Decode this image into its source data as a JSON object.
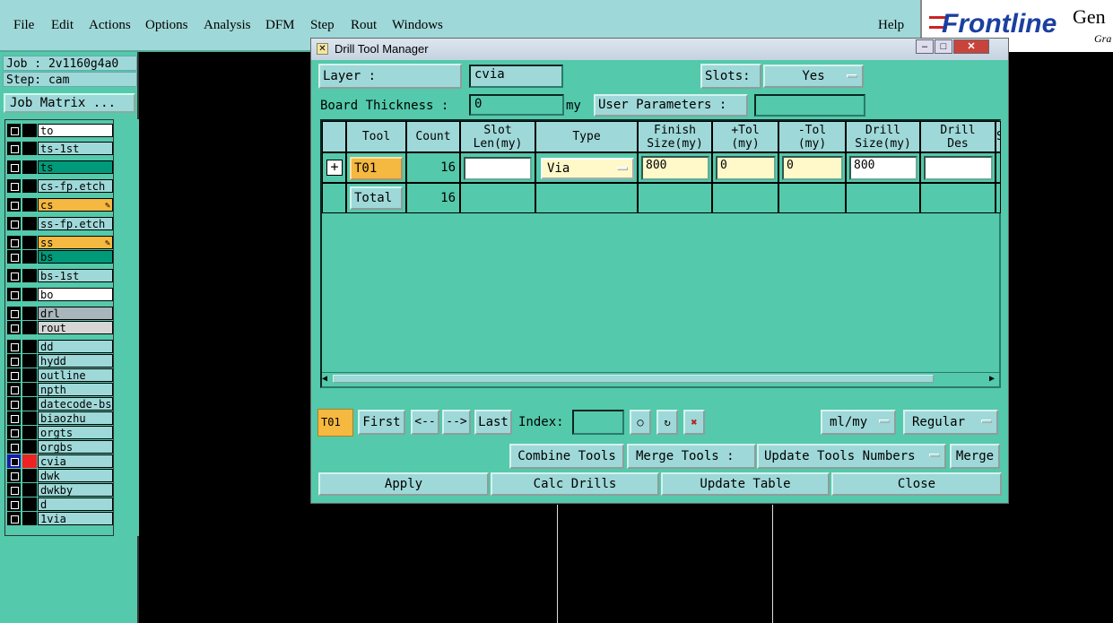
{
  "menubar": {
    "items": [
      "File",
      "Edit",
      "Actions",
      "Options",
      "Analysis",
      "DFM",
      "Step",
      "Rout",
      "Windows"
    ],
    "help": "Help"
  },
  "logo": {
    "brand": "Frontline",
    "text1": "Gen",
    "text2": "Gra"
  },
  "job": {
    "job_line": "Job : 2v1160g4a0",
    "step_line": "Step: cam",
    "matrix_button": "Job Matrix ..."
  },
  "layers": [
    {
      "name": "to",
      "color": "#ffffff"
    },
    {
      "name": "ts-1st",
      "color": "#9fd8d8"
    },
    {
      "name": "ts",
      "color": "#009a7a"
    },
    {
      "name": "cs-fp.etch",
      "color": "#9fd8d8"
    },
    {
      "name": "cs",
      "color": "#f5b840"
    },
    {
      "name": "ss-fp.etch",
      "color": "#9fd8d8"
    },
    {
      "name": "ss",
      "color": "#f5b840"
    },
    {
      "name": "bs",
      "color": "#009a7a"
    },
    {
      "name": "bs-1st",
      "color": "#9fd8d8"
    },
    {
      "name": "bo",
      "color": "#ffffff"
    },
    {
      "name": "drl",
      "color": "#a9b6bc"
    },
    {
      "name": "rout",
      "color": "#d6d6d6"
    },
    {
      "name": "dd",
      "color": "#9fd8d8"
    },
    {
      "name": "hydd",
      "color": "#9fd8d8"
    },
    {
      "name": "outline",
      "color": "#9fd8d8"
    },
    {
      "name": "npth",
      "color": "#9fd8d8"
    },
    {
      "name": "datecode-bs",
      "color": "#9fd8d8"
    },
    {
      "name": "biaozhu",
      "color": "#9fd8d8"
    },
    {
      "name": "orgts",
      "color": "#9fd8d8"
    },
    {
      "name": "orgbs",
      "color": "#9fd8d8"
    },
    {
      "name": "cvia",
      "color": "#9fd8d8"
    },
    {
      "name": "dwk",
      "color": "#9fd8d8"
    },
    {
      "name": "dwkby",
      "color": "#9fd8d8"
    },
    {
      "name": "d",
      "color": "#9fd8d8"
    },
    {
      "name": "1via",
      "color": "#9fd8d8"
    }
  ],
  "dialog": {
    "title": "Drill Tool Manager",
    "layer_label": "Layer          :",
    "layer_value": "cvia",
    "slots_label": "Slots:",
    "slots_value": "Yes",
    "thickness_label": "Board Thickness :",
    "thickness_value": "0",
    "thickness_unit": "my",
    "user_params_label": "User Parameters :",
    "user_params_value": "",
    "columns": {
      "tool": "Tool",
      "count": "Count",
      "slot_len": [
        "Slot",
        "Len(my)"
      ],
      "type": "Type",
      "finish": [
        "Finish",
        "Size(my)"
      ],
      "ptol": [
        "+Tol",
        "(my)"
      ],
      "ntol": [
        "-Tol",
        "(my)"
      ],
      "drill_size": [
        "Drill",
        "Size(my)"
      ],
      "drill_des": [
        "Drill",
        "Des"
      ],
      "extra": "S"
    },
    "row": {
      "expand": "+",
      "tool": "T01",
      "count": "16",
      "slot_len": "",
      "type": "Via",
      "finish": "800",
      "ptol": "0",
      "ntol": "0",
      "drill_size": "800",
      "drill_des": ""
    },
    "total": {
      "label": "Total",
      "count": "16"
    },
    "nav": {
      "current": "T01",
      "first": "First",
      "prev": "<--",
      "next": "-->",
      "last": "Last",
      "index_label": "Index:",
      "index_value": "",
      "units": "ml/my",
      "mode": "Regular"
    },
    "combine": "Combine Tools",
    "merge_label": "Merge Tools :",
    "merge_option": "Update Tools Numbers",
    "merge": "Merge",
    "apply": "Apply",
    "calc": "Calc Drills",
    "update": "Update Table",
    "close": "Close"
  }
}
